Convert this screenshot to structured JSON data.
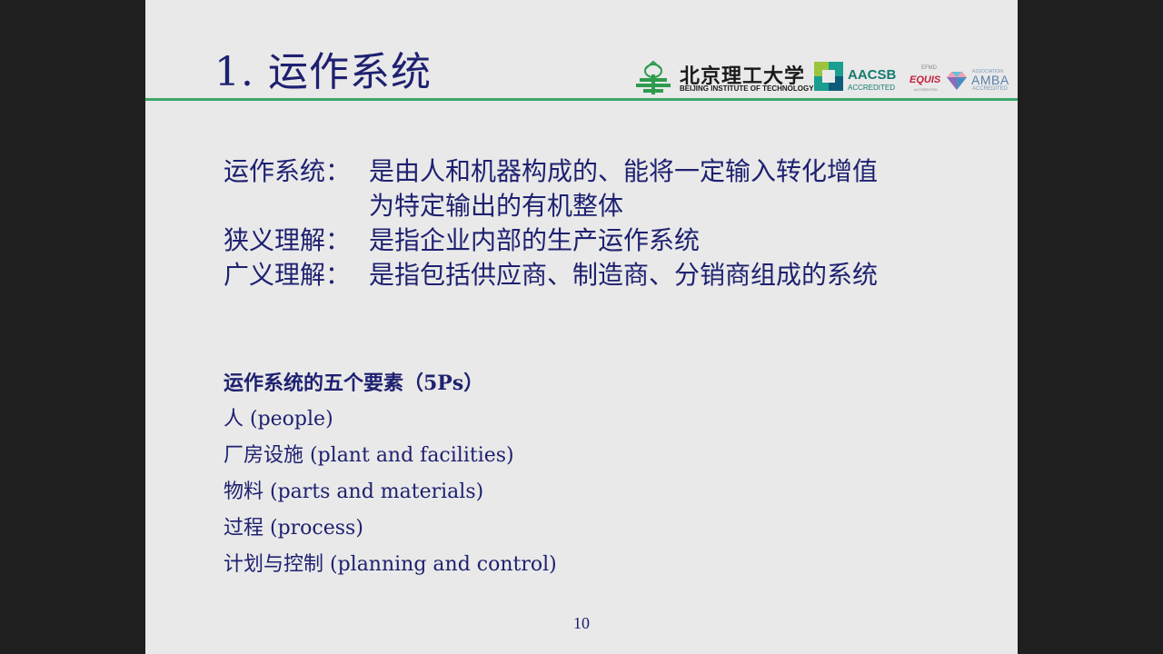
{
  "slide": {
    "title": "1. 运作系统",
    "logos": {
      "university_cn": "北京理工大学",
      "university_en": "BEIJING INSTITUTE OF TECHNOLOGY",
      "aacsb": "AACSB",
      "aacsb_sub": "ACCREDITED",
      "efmd": "EFMD",
      "equis": "EQUIS",
      "equis_sub": "ACCREDITED",
      "amba_assoc": "ASSOCIATION",
      "amba": "AMBA",
      "amba_sub": "ACCREDITED"
    },
    "definitions": [
      {
        "term": "运作系统：",
        "lines": [
          "是由人和机器构成的、能将一定输入转化增值",
          "为特定输出的有机整体"
        ]
      },
      {
        "term": "狭义理解：",
        "lines": [
          "是指企业内部的生产运作系统"
        ]
      },
      {
        "term": "广义理解：",
        "lines": [
          "是指包括供应商、制造商、分销商组成的系统"
        ]
      }
    ],
    "elements_heading": "运作系统的五个要素（5Ps）",
    "elements": [
      "人 (people)",
      "厂房设施 (plant and facilities)",
      "物料 (parts and materials)",
      "过程 (process)",
      "计划与控制 (planning and control)"
    ],
    "page_number": "10"
  },
  "colors": {
    "text": "#1e2170",
    "rule": "#3aa86a",
    "slide_bg": "#e9e9e9",
    "frame_bg": "#1f1f1f"
  }
}
